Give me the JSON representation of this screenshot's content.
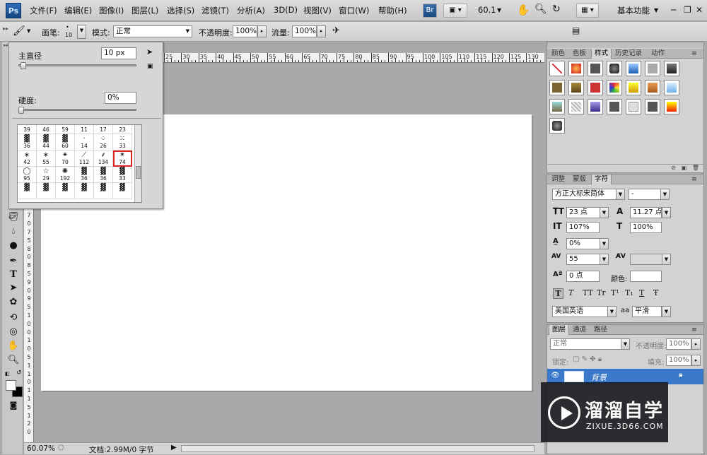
{
  "app": {
    "logo": "Ps"
  },
  "menu": {
    "items": [
      "文件(F)",
      "编辑(E)",
      "图像(I)",
      "图层(L)",
      "选择(S)",
      "滤镜(T)",
      "分析(A)",
      "3D(D)",
      "视图(V)",
      "窗口(W)",
      "帮助(H)"
    ],
    "bridge_label": "Br",
    "zoom_value": "60.1",
    "workspace": "基本功能"
  },
  "options": {
    "brush_label": "画笔:",
    "brush_size": "10",
    "mode_label": "模式:",
    "mode_value": "正常",
    "opacity_label": "不透明度:",
    "opacity_value": "100%",
    "flow_label": "流量:",
    "flow_value": "100%"
  },
  "brush_popup": {
    "diameter_label": "主直径",
    "diameter_value": "10 px",
    "diameter_fraction": 0.02,
    "hardness_label": "硬度:",
    "hardness_value": "0%",
    "hardness_fraction": 0.0,
    "rows": [
      [
        "39",
        "46",
        "59",
        "11",
        "17",
        "23"
      ],
      [
        "36",
        "44",
        "60",
        "14",
        "26",
        "33"
      ],
      [
        "42",
        "55",
        "70",
        "112",
        "134",
        "74"
      ],
      [
        "95",
        "29",
        "192",
        "36",
        "36",
        "33"
      ]
    ],
    "selected": "74"
  },
  "ruler": {
    "h_ticks": [
      "25",
      "30",
      "35",
      "40",
      "45",
      "50",
      "55",
      "60",
      "65",
      "70",
      "75",
      "80",
      "85",
      "90",
      "95",
      "100",
      "105",
      "110",
      "115",
      "120",
      "125",
      "130"
    ],
    "v_ticks": [
      "2",
      "5",
      "3",
      "0",
      "3",
      "5",
      "4",
      "0",
      "4",
      "5",
      "5",
      "0",
      "5",
      "5",
      "6",
      "0",
      "6",
      "5",
      "7",
      "0",
      "7",
      "5",
      "8",
      "0",
      "8",
      "5",
      "9",
      "0",
      "9",
      "5",
      "1",
      "0",
      "0",
      "1",
      "0",
      "5",
      "1",
      "1",
      "0",
      "1",
      "1",
      "5",
      "1",
      "2",
      "0"
    ]
  },
  "status": {
    "zoom": "60.07%",
    "doc_info": "文档:2.99M/0 字节"
  },
  "panels": {
    "styles_tabs": [
      "颜色",
      "色板",
      "样式",
      "历史记录",
      "动作"
    ],
    "styles_active": "样式",
    "character_tabs": [
      "调整",
      "蒙版",
      "字符"
    ],
    "character_active": "字符",
    "font_family": "方正大标宋简体",
    "font_style": "-",
    "font_size": "23 点",
    "leading": "11.27 点",
    "vertical_scale": "107%",
    "horizontal_scale": "100%",
    "tracking_percent": "0%",
    "tracking": "55",
    "baseline_shift": "0 点",
    "color_label": "颜色:",
    "language": "美国英语",
    "antialias_label": "aa",
    "antialias": "平滑",
    "type_buttons": [
      "T",
      "T",
      "TT",
      "Tr",
      "T¹",
      "T₁",
      "T",
      "Ŧ"
    ],
    "layers_tabs": [
      "图层",
      "通道",
      "路径"
    ],
    "layers_active": "图层",
    "blend_mode": "正常",
    "layer_opacity_label": "不透明度:",
    "layer_opacity": "100%",
    "lock_label": "锁定:",
    "fill_label": "填充:",
    "fill": "100%",
    "layer_name": "背景"
  },
  "watermark": {
    "brand": "溜溜自学",
    "url": "ZIXUE.3D66.COM"
  },
  "colors": {
    "selection_red": "#d22222",
    "layer_selected": "#3a78c9",
    "watermark_bg": "#1f1f24"
  }
}
